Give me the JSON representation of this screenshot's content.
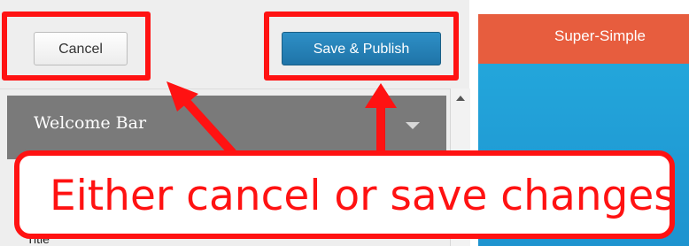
{
  "header": {
    "cancel_label": "Cancel",
    "publish_label": "Save & Publish"
  },
  "sections": [
    {
      "label": "Welcome Bar"
    }
  ],
  "panel_bottom_text": "Title",
  "preview": {
    "title": "Super-Simple"
  },
  "annotation": {
    "text": "Either cancel or save changes"
  },
  "colors": {
    "highlight": "#ff1212",
    "publish_button": "#2a86bd",
    "preview_bar": "#e75d3e",
    "preview_sky": "#27a8dc"
  },
  "icons": {
    "section_toggle": "chevron-down-icon",
    "scroll_up": "scroll-up-arrow-icon",
    "pointer": "arrow-icon"
  }
}
